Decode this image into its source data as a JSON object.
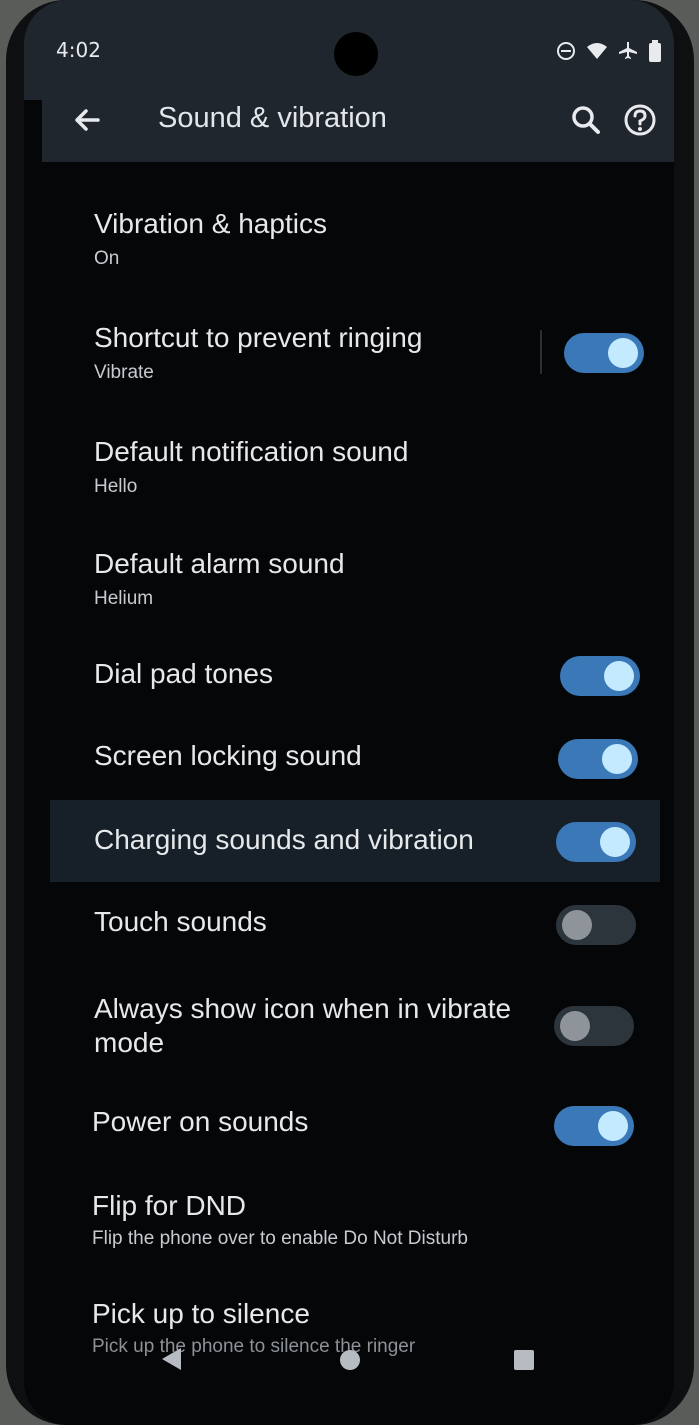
{
  "status_bar": {
    "time": "4:02",
    "icons": [
      "do-not-disturb-icon",
      "wifi-icon",
      "airplane-icon",
      "battery-icon"
    ]
  },
  "app_bar": {
    "title": "Sound & vibration",
    "back_icon": "arrow-back-icon",
    "search_icon": "search-icon",
    "help_icon": "help-icon"
  },
  "settings": [
    {
      "label": "Vibration & haptics",
      "summary": "On"
    },
    {
      "label": "Shortcut to prevent ringing",
      "summary": "Vibrate",
      "toggle": true
    },
    {
      "label": "Default notification sound",
      "summary": "Hello"
    },
    {
      "label": "Default alarm sound",
      "summary": "Helium"
    },
    {
      "label": "Dial pad tones",
      "toggle": true
    },
    {
      "label": "Screen locking sound",
      "toggle": true
    },
    {
      "label": "Charging sounds and vibration",
      "toggle": true
    },
    {
      "label": "Touch sounds",
      "toggle": false
    },
    {
      "label": "Always show icon when in vibrate mode",
      "toggle": false
    },
    {
      "label": "Power on sounds",
      "toggle": true
    },
    {
      "label": "Flip for DND",
      "summary": "Flip the phone over to enable Do Not Disturb"
    },
    {
      "label": "Pick up to silence",
      "summary": "Pick up the phone to silence the ringer"
    }
  ],
  "nav_bar": {
    "icons": [
      "nav-back-icon",
      "nav-home-icon",
      "nav-recents-icon"
    ]
  },
  "colors": {
    "toggle_on": "#3a78b8",
    "knob_on": "#c4eaff",
    "background": "#040608",
    "app_bar": "#1f262e"
  }
}
